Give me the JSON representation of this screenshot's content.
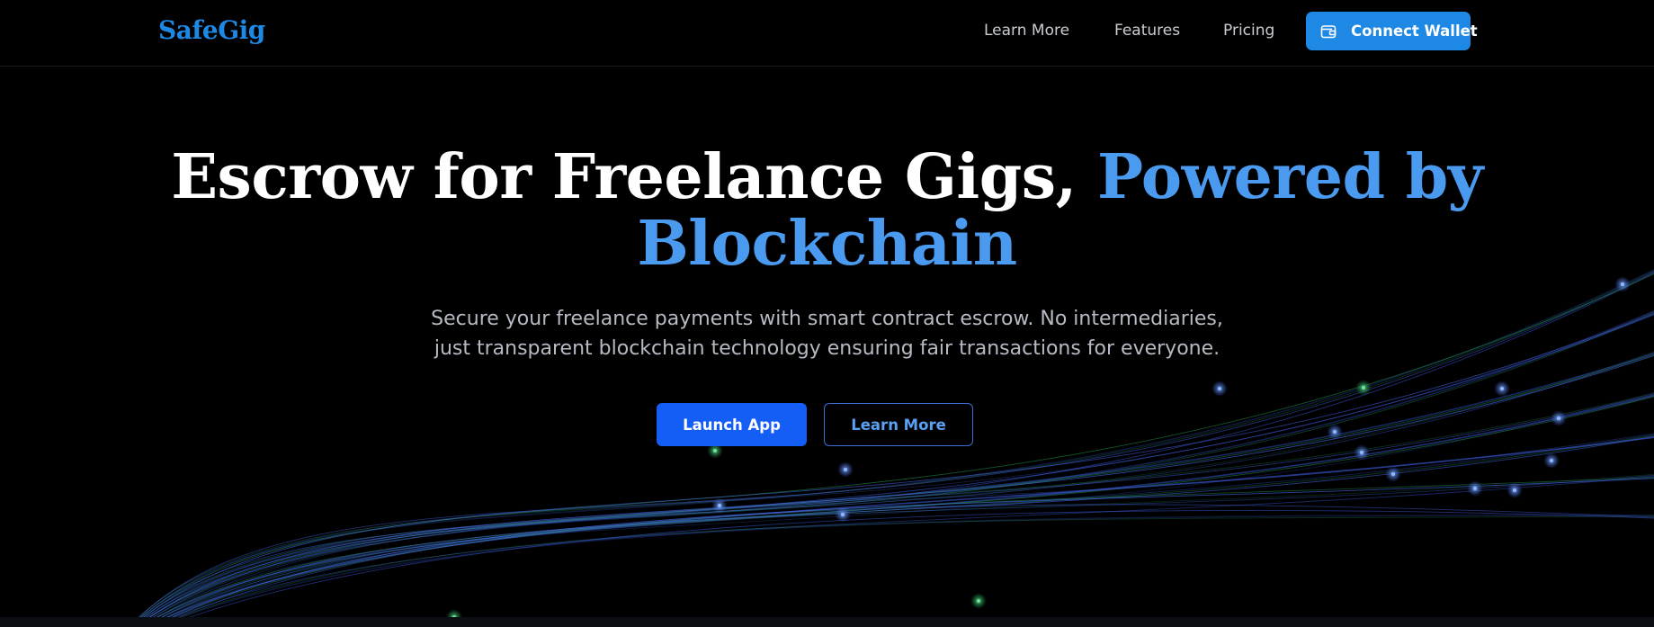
{
  "brand": {
    "name": "SafeGig",
    "color": "#1e88e5"
  },
  "nav": {
    "links": [
      {
        "label": "Learn More"
      },
      {
        "label": "Features"
      },
      {
        "label": "Pricing"
      }
    ],
    "connect_wallet": {
      "label": "Connect Wallet",
      "icon": "wallet-icon",
      "color": "#1e88e5"
    }
  },
  "hero": {
    "title_main": "Escrow for Freelance Gigs, ",
    "title_accent": "Powered by Blockchain",
    "accent_color": "#4a9af0",
    "subtitle": "Secure your freelance payments with smart contract escrow. No intermediaries, just transparent blockchain technology ensuring fair transactions for everyone."
  },
  "cta": {
    "launch_app": {
      "label": "Launch App",
      "color": "#155ef5"
    },
    "learn_more": {
      "label": "Learn More"
    }
  },
  "background": {
    "color": "#000000",
    "wave_colors": [
      "#3b5bdb",
      "#1f8a4c",
      "#4c6ef5"
    ]
  }
}
